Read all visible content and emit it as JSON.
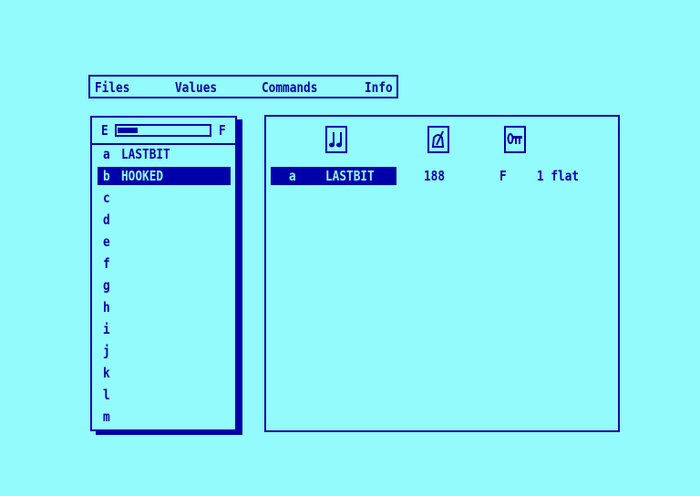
{
  "menu": {
    "items": [
      {
        "label": "Files"
      },
      {
        "label": "Values"
      },
      {
        "label": "Commands"
      },
      {
        "label": "Info"
      }
    ]
  },
  "list_panel": {
    "gauge_left_label": "E",
    "gauge_right_label": "F",
    "gauge_fill_fraction": 0.22,
    "rows": [
      {
        "letter": "a",
        "name": "LASTBIT",
        "selected": false
      },
      {
        "letter": "b",
        "name": "HOOKED",
        "selected": true
      },
      {
        "letter": "c",
        "name": ""
      },
      {
        "letter": "d",
        "name": ""
      },
      {
        "letter": "e",
        "name": ""
      },
      {
        "letter": "f",
        "name": ""
      },
      {
        "letter": "g",
        "name": ""
      },
      {
        "letter": "h",
        "name": ""
      },
      {
        "letter": "i",
        "name": ""
      },
      {
        "letter": "j",
        "name": ""
      },
      {
        "letter": "k",
        "name": ""
      },
      {
        "letter": "l",
        "name": ""
      },
      {
        "letter": "m",
        "name": ""
      }
    ]
  },
  "detail_panel": {
    "icons": [
      "notes-icon",
      "metronome-icon",
      "key-icon"
    ],
    "row": {
      "letter": "a",
      "name": "LASTBIT",
      "tempo": "188",
      "key": "F",
      "signature": "1 flat"
    }
  },
  "colors": {
    "background": "#93fbfb",
    "foreground": "#0000aa"
  }
}
